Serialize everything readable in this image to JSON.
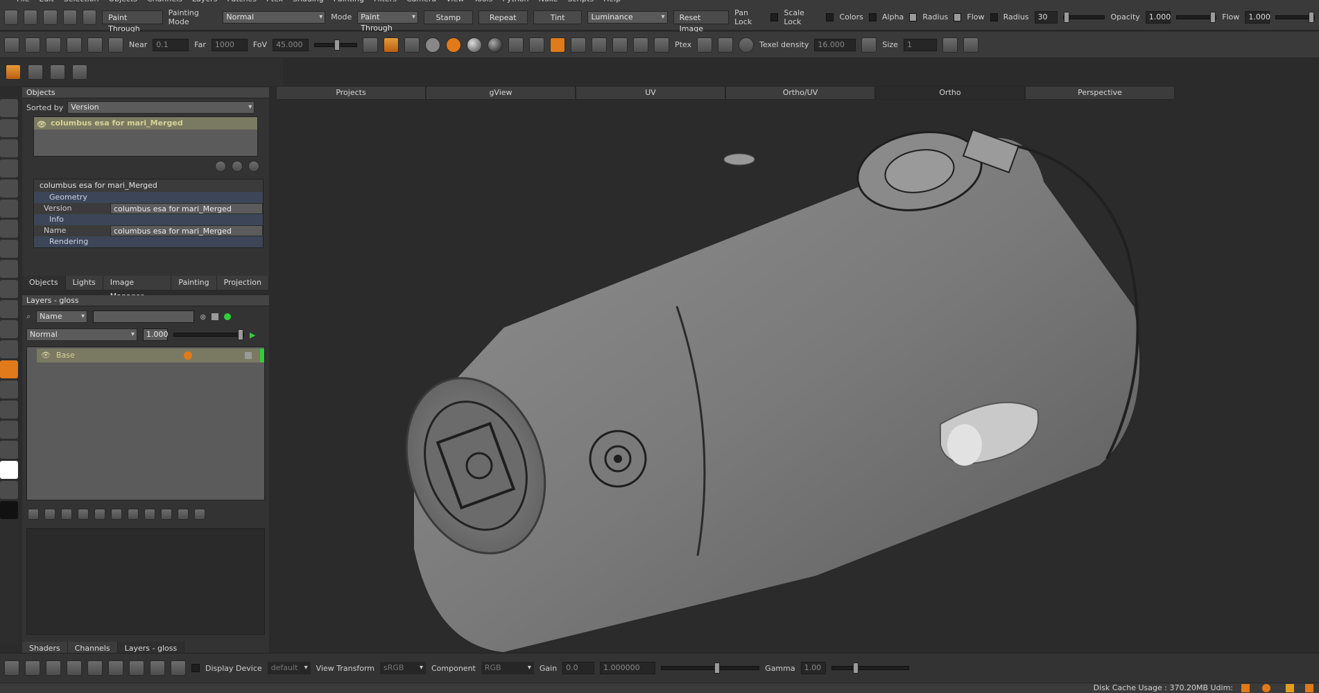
{
  "menubar": [
    "File",
    "Edit",
    "Selection",
    "Objects",
    "Channels",
    "Layers",
    "Patches",
    "Ptex",
    "Shading",
    "Painting",
    "Filters",
    "Camera",
    "View",
    "Tools",
    "Python",
    "Nuke",
    "Scripts",
    "Help"
  ],
  "toolbar1": {
    "paint_through": "Paint Through",
    "painting_mode_label": "Painting Mode",
    "painting_mode_value": "Normal",
    "mode_label": "Mode",
    "mode_value": "Paint Through",
    "stamp": "Stamp",
    "repeat": "Repeat",
    "tint": "Tint",
    "luminance": "Luminance",
    "reset_image": "Reset Image",
    "pan_lock": "Pan Lock",
    "scale_lock": "Scale Lock",
    "colors": "Colors",
    "alpha": "Alpha",
    "radius": "Radius",
    "flow": "Flow",
    "radius2": "Radius",
    "radius_value": "30",
    "opacity_label": "Opacity",
    "opacity_value": "1.000",
    "flow_label": "Flow",
    "flow_value": "1.000"
  },
  "toolbar2": {
    "near_label": "Near",
    "near_value": "0.1",
    "far_label": "Far",
    "far_value": "1000",
    "fov_label": "FoV",
    "fov_value": "45.000",
    "ptex": "Ptex",
    "texel_label": "Texel density",
    "texel_value": "16.000",
    "size_label": "Size",
    "size_value": "1"
  },
  "objects_panel": {
    "title": "Objects",
    "sorted_by_label": "Sorted by",
    "sorted_by_value": "Version",
    "object_name": "columbus esa for mari_Merged",
    "props_title": "columbus esa for mari_Merged",
    "sections": [
      {
        "name": "Geometry",
        "rows": [
          {
            "key": "Version",
            "value": "columbus esa for mari_Merged"
          }
        ]
      },
      {
        "name": "Info",
        "rows": [
          {
            "key": "Name",
            "value": "columbus esa for mari_Merged"
          }
        ]
      },
      {
        "name": "Rendering",
        "rows": []
      }
    ],
    "tabs": [
      "Objects",
      "Lights",
      "Image Manager",
      "Painting",
      "Projection"
    ]
  },
  "layers_panel": {
    "title": "Layers - gloss",
    "filter_value": "Name",
    "blend_value": "Normal",
    "opacity_value": "1.000",
    "layers": [
      {
        "name": "Base"
      }
    ],
    "bottom_tabs": [
      "Shaders",
      "Channels",
      "Layers - gloss"
    ]
  },
  "viewport": {
    "tabs": [
      "Projects",
      "gView",
      "UV",
      "Ortho/UV",
      "Ortho",
      "Perspective"
    ],
    "active_tab": "Ortho"
  },
  "bottom_bar": {
    "display_device_label": "Display Device",
    "display_device_value": "default",
    "view_transform_label": "View Transform",
    "view_transform_value": "sRGB",
    "component_label": "Component",
    "component_value": "RGB",
    "gain_label": "Gain",
    "gain_value": "0.0",
    "gain_value2": "1.000000",
    "gamma_label": "Gamma",
    "gamma_value": "1.00"
  },
  "status": {
    "disk_cache": "Disk Cache Usage : 370.20MB",
    "udim": "Udim:"
  },
  "colors": {
    "accent_orange": "#e07a1a",
    "green": "#2fcf3a",
    "selected_row": "#7a7a62"
  }
}
